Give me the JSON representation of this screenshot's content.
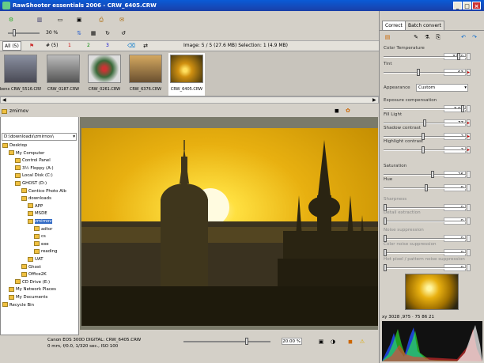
{
  "window": {
    "title": "RawShooter essentials 2006 - CRW_6405.CRW"
  },
  "toolbar": {
    "zoom": "30 %",
    "image_info": "Image: 5 / 5 (27.6 MB) Selection: 1 (4.9 MB)"
  },
  "filter_tabs": [
    "All (5)",
    "# (5)",
    "1",
    "2",
    "3"
  ],
  "thumbnails": [
    {
      "caption": "benx CRW_5516.CRW",
      "color": "#5a6070"
    },
    {
      "caption": "CRW_0187.CRW",
      "color": "#6a6a60"
    },
    {
      "caption": "CRW_0261.CRW",
      "color": "#406040"
    },
    {
      "caption": "CRW_6376.CRW",
      "color": "#907040"
    },
    {
      "caption": "CRW_6405.CRW",
      "color": "#c08010"
    }
  ],
  "folder": {
    "header": "zmirnov",
    "path": "D:\\downloads\\zmirnov\\",
    "tree": [
      {
        "label": "Desktop",
        "indent": 0
      },
      {
        "label": "My Computer",
        "indent": 1
      },
      {
        "label": "Control Panel",
        "indent": 2
      },
      {
        "label": "3½ Floppy (A:)",
        "indent": 2
      },
      {
        "label": "Local Disk (C:)",
        "indent": 2
      },
      {
        "label": "GHOST (D:)",
        "indent": 2
      },
      {
        "label": "Centico Photo Alb",
        "indent": 3
      },
      {
        "label": "downloads",
        "indent": 3
      },
      {
        "label": "APP",
        "indent": 4
      },
      {
        "label": "MSDE",
        "indent": 4
      },
      {
        "label": "zmirnov",
        "indent": 4,
        "selected": true
      },
      {
        "label": "adtor",
        "indent": 5
      },
      {
        "label": "cs",
        "indent": 5
      },
      {
        "label": "exe",
        "indent": 5
      },
      {
        "label": "reading",
        "indent": 5
      },
      {
        "label": "UAT",
        "indent": 4
      },
      {
        "label": "Ghost",
        "indent": 3
      },
      {
        "label": "Office2K",
        "indent": 3
      },
      {
        "label": "CD Drive (E:)",
        "indent": 2
      },
      {
        "label": "My Network Places",
        "indent": 1
      },
      {
        "label": "My Documents",
        "indent": 1
      },
      {
        "label": "Recycle Bin",
        "indent": 0
      }
    ]
  },
  "status": {
    "line1": "Canon EOS 300D DIGITAL:  CRW_6405.CRW",
    "line2": "0 mm, f/0.0, 1/320 sec., ISO 100",
    "zoom": "20.00 %"
  },
  "right": {
    "tabs": [
      "Correct",
      "Batch convert"
    ],
    "params": [
      {
        "label": "Color Temperature",
        "value": "3250",
        "level": 0.93
      },
      {
        "label": "Tint",
        "value": "-63",
        "level": 0.42
      },
      {
        "label": "Exposure compensation",
        "value": "3.00",
        "level": 0.98
      },
      {
        "label": "Fill Light",
        "value": "77",
        "level": 0.5
      },
      {
        "label": "Shadow contrast",
        "value": "-2",
        "level": 0.48
      },
      {
        "label": "Highlight contrast",
        "value": "-2",
        "level": 0.48
      },
      {
        "label": "Saturation",
        "value": "26",
        "level": 0.6
      },
      {
        "label": "Hue",
        "value": "9",
        "level": 0.52
      },
      {
        "label": "Sharpness",
        "value": "0",
        "level": 0.0
      },
      {
        "label": "Detail extraction",
        "value": "0",
        "level": 0.0
      },
      {
        "label": "Noise suppression",
        "value": "0",
        "level": 0.0
      },
      {
        "label": "Color noise suppression",
        "value": "0",
        "level": 0.0
      },
      {
        "label": "Hot pixel / pattern noise suppression",
        "value": "0",
        "level": 0.0
      }
    ],
    "appearance_label": "Appearance",
    "appearance_value": "Custom",
    "readout": "xy  3028 ,975  ·  75    86    21"
  }
}
